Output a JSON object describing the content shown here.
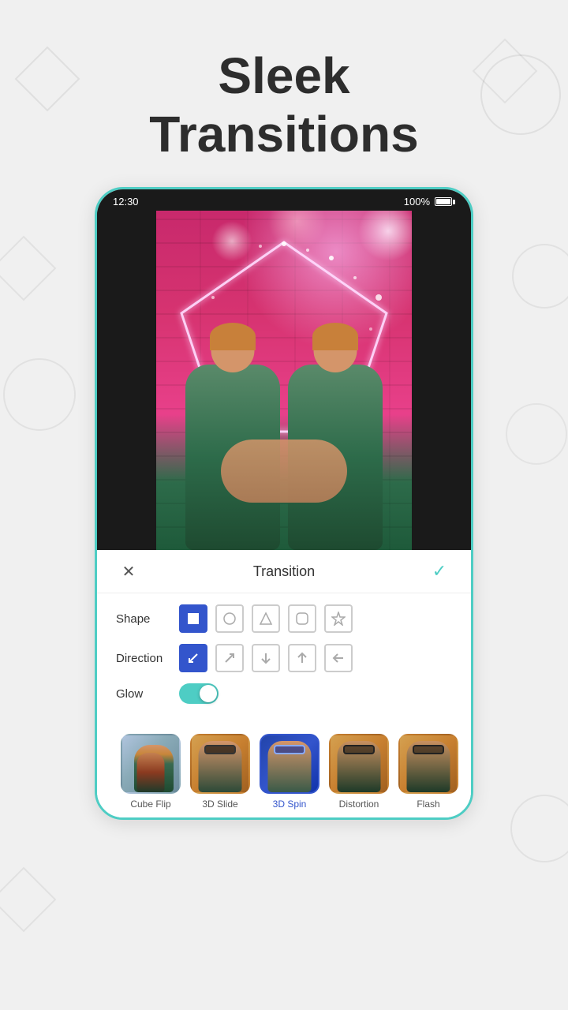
{
  "title": {
    "line1": "Sleek",
    "line2": "Transitions"
  },
  "phone": {
    "statusBar": {
      "time": "12:30",
      "battery": "100%"
    },
    "toolbar": {
      "closeLabel": "✕",
      "title": "Transition",
      "checkLabel": "✓"
    },
    "controls": {
      "shape": {
        "label": "Shape",
        "options": [
          "square",
          "circle",
          "triangle",
          "rounded-square",
          "star"
        ]
      },
      "direction": {
        "label": "Direction",
        "options": [
          "diagonal-in",
          "diagonal-out",
          "down",
          "up",
          "left"
        ]
      },
      "glow": {
        "label": "Glow",
        "enabled": true
      }
    },
    "transitions": [
      {
        "id": "cube-flip",
        "label": "Cube Flip",
        "selected": false
      },
      {
        "id": "3d-slide",
        "label": "3D Slide",
        "selected": false
      },
      {
        "id": "3d-spin",
        "label": "3D Spin",
        "selected": true
      },
      {
        "id": "distortion",
        "label": "Distortion",
        "selected": false
      },
      {
        "id": "flash",
        "label": "Flash",
        "selected": false
      }
    ]
  }
}
